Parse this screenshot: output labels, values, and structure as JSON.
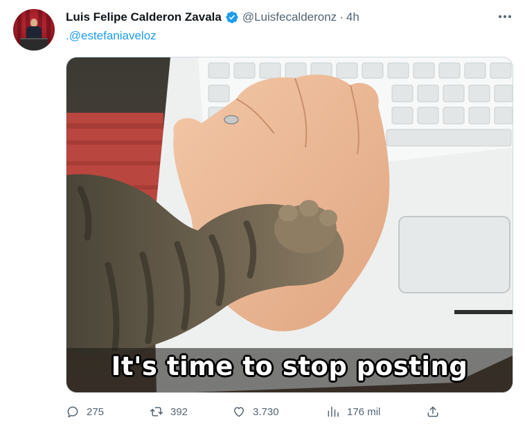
{
  "tweet": {
    "author_name": "Luis Felipe Calderon Zavala",
    "handle": "@Luisfecalderonz",
    "separator": "·",
    "time": "4h",
    "reply_text": ".@estefaniaveloz",
    "media_caption": "It's time to stop posting"
  },
  "actions": {
    "replies": "275",
    "retweets": "392",
    "likes": "3.730",
    "views": "176 mil"
  },
  "icons": {
    "verified": "verified-badge-icon",
    "more": "more-dots-icon",
    "reply": "reply-icon",
    "retweet": "retweet-icon",
    "like": "heart-icon",
    "views": "views-chart-icon",
    "share": "share-icon"
  },
  "colors": {
    "accent": "#1d9bf0",
    "muted": "#536471",
    "text": "#0f1419"
  }
}
